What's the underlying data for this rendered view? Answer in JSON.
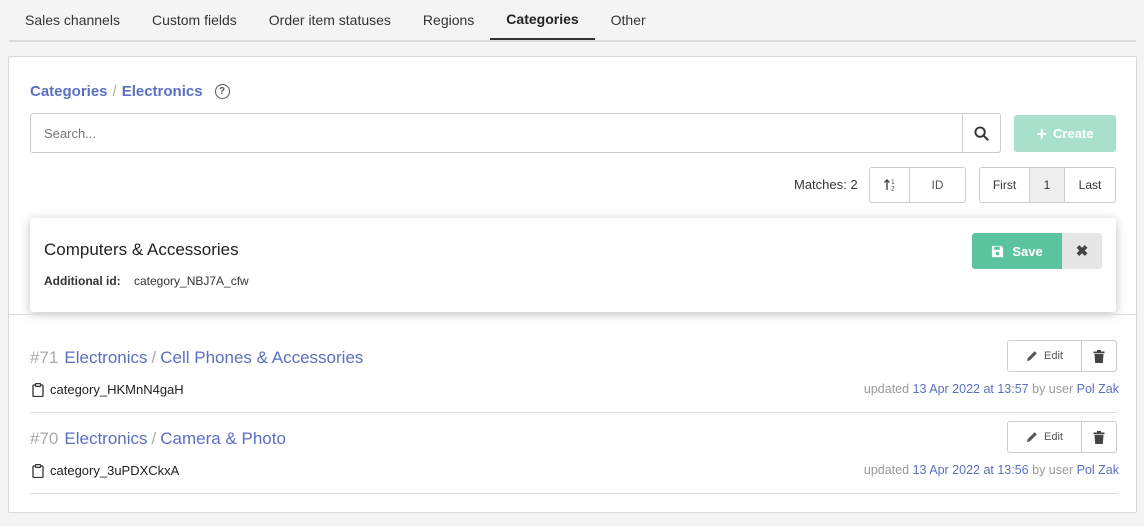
{
  "tabs": [
    {
      "label": "Sales channels"
    },
    {
      "label": "Custom fields"
    },
    {
      "label": "Order item statuses"
    },
    {
      "label": "Regions"
    },
    {
      "label": "Categories"
    },
    {
      "label": "Other"
    }
  ],
  "breadcrumb": {
    "root": "Categories",
    "sep": "/",
    "current": "Electronics"
  },
  "search": {
    "placeholder": "Search...",
    "value": ""
  },
  "create_label": "Create",
  "matches_text": "Matches: 2",
  "sort": {
    "field_label": "ID"
  },
  "pager": {
    "first": "First",
    "current": "1",
    "last": "Last"
  },
  "editor": {
    "name_value": "Computers & Accessories",
    "additional_id_label": "Additional id:",
    "additional_id_value": "category_NBJ7A_cfw",
    "save_label": "Save"
  },
  "rows": [
    {
      "num": "#71",
      "parent": "Electronics",
      "sep": "/",
      "name": "Cell Phones & Accessories",
      "code": "category_HKMnN4gaH",
      "updated_prefix": "updated",
      "updated_date": "13 Apr 2022 at 13:57",
      "by_user": "by user",
      "user": "Pol Zak",
      "edit_label": "Edit"
    },
    {
      "num": "#70",
      "parent": "Electronics",
      "sep": "/",
      "name": "Camera & Photo",
      "code": "category_3uPDXCkxA",
      "updated_prefix": "updated",
      "updated_date": "13 Apr 2022 at 13:56",
      "by_user": "by user",
      "user": "Pol Zak",
      "edit_label": "Edit"
    }
  ],
  "colors": {
    "accent": "#5b6fc0",
    "save": "#5bc39e",
    "create_disabled": "#a8e0cc"
  }
}
